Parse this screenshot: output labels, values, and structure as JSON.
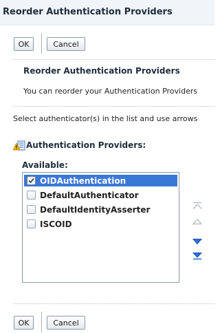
{
  "dialog": {
    "title": "Reorder Authentication Providers"
  },
  "top_buttons": {
    "ok": "OK",
    "cancel": "Cancel"
  },
  "content": {
    "heading": "Reorder Authentication Providers",
    "description": "You can reorder your Authentication Providers",
    "instruction": "Select authenticator(s) in the list and use arrows"
  },
  "providers": {
    "label": "Authentication Providers:",
    "available_label": "Available:",
    "items": [
      {
        "label": "OIDAuthentication",
        "checked": true,
        "selected": true
      },
      {
        "label": "DefaultAuthenticator",
        "checked": false,
        "selected": false
      },
      {
        "label": "DefaultIdentityAsserter",
        "checked": false,
        "selected": false
      },
      {
        "label": "ISCOID",
        "checked": false,
        "selected": false
      }
    ],
    "move_buttons": [
      "move-to-top-icon",
      "move-up-icon",
      "move-down-icon",
      "move-to-bottom-icon"
    ]
  },
  "bottom_buttons": {
    "ok": "OK",
    "cancel": "Cancel"
  },
  "colors": {
    "selection": "#3a78d8",
    "heading_text": "#1f2d3d",
    "arrow_enabled": "#2f6fd6",
    "arrow_disabled": "#b9c1cb"
  }
}
